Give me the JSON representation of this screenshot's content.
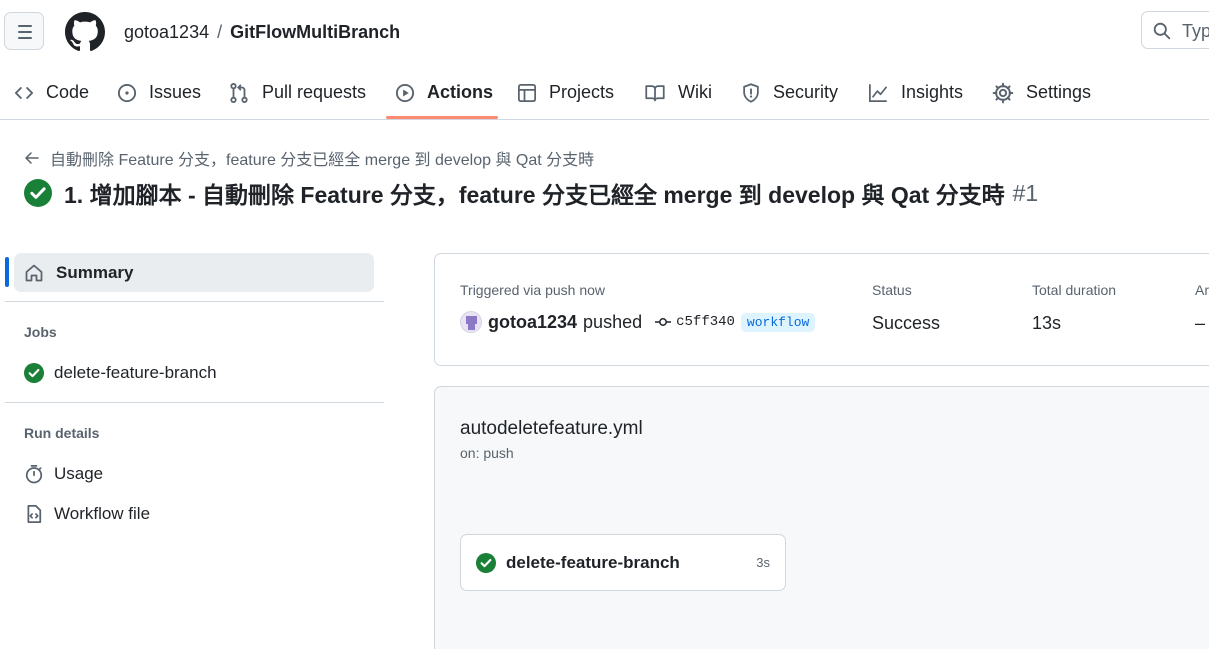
{
  "header": {
    "owner": "gotoa1234",
    "separator": "/",
    "repo": "GitFlowMultiBranch",
    "search_placeholder": "Typ"
  },
  "tabs": [
    {
      "label": "Code",
      "icon": "code-icon"
    },
    {
      "label": "Issues",
      "icon": "issue-icon"
    },
    {
      "label": "Pull requests",
      "icon": "pull-request-icon"
    },
    {
      "label": "Actions",
      "icon": "play-icon",
      "active": true
    },
    {
      "label": "Projects",
      "icon": "table-icon"
    },
    {
      "label": "Wiki",
      "icon": "book-icon"
    },
    {
      "label": "Security",
      "icon": "shield-icon"
    },
    {
      "label": "Insights",
      "icon": "graph-icon"
    },
    {
      "label": "Settings",
      "icon": "gear-icon"
    }
  ],
  "run": {
    "back_label": "自動刪除 Feature 分支，feature 分支已經全 merge 到 develop 與 Qat 分支時",
    "title": "1. 增加腳本 - 自動刪除 Feature 分支，feature 分支已經全 merge 到 develop 與 Qat 分支時",
    "number": "#1",
    "status_color": "#1a7f37"
  },
  "sidebar": {
    "summary_label": "Summary",
    "jobs_heading": "Jobs",
    "jobs": [
      {
        "label": "delete-feature-branch",
        "status": "success"
      }
    ],
    "run_details_heading": "Run details",
    "details": [
      {
        "label": "Usage",
        "icon": "stopwatch-icon"
      },
      {
        "label": "Workflow file",
        "icon": "file-code-icon"
      }
    ]
  },
  "summary": {
    "trigger_label": "Triggered via push now",
    "actor": "gotoa1234",
    "action": "pushed",
    "commit": "c5ff340",
    "branch": "workflow",
    "status_label": "Status",
    "status_value": "Success",
    "duration_label": "Total duration",
    "duration_value": "13s",
    "artifacts_label": "Ar",
    "artifacts_value": "–"
  },
  "workflow": {
    "file": "autodeletefeature.yml",
    "trigger": "on: push",
    "job_name": "delete-feature-branch",
    "job_duration": "3s"
  }
}
